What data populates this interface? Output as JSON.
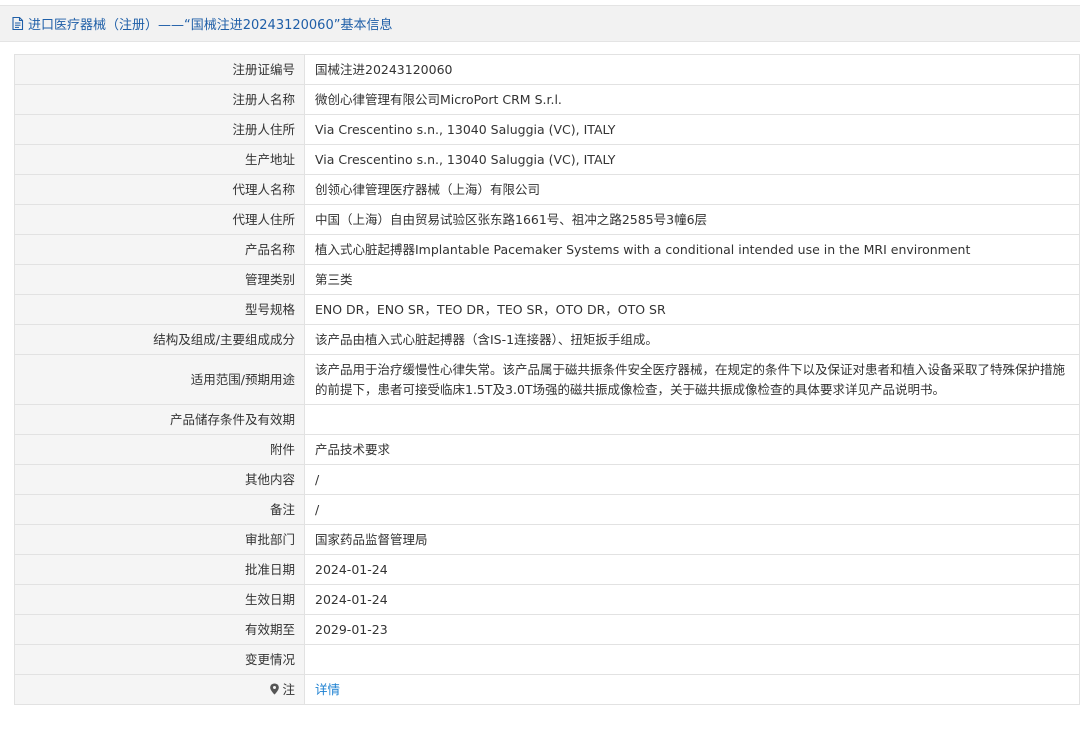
{
  "header": {
    "title": "进口医疗器械（注册）——“国械注进20243120060”基本信息"
  },
  "rows": [
    {
      "label": "注册证编号",
      "value": "国械注进20243120060"
    },
    {
      "label": "注册人名称",
      "value": "微创心律管理有限公司MicroPort CRM S.r.l."
    },
    {
      "label": "注册人住所",
      "value": "Via Crescentino s.n., 13040 Saluggia (VC), ITALY"
    },
    {
      "label": "生产地址",
      "value": "Via Crescentino s.n., 13040 Saluggia (VC), ITALY"
    },
    {
      "label": "代理人名称",
      "value": "创领心律管理医疗器械（上海）有限公司"
    },
    {
      "label": "代理人住所",
      "value": "中国（上海）自由贸易试验区张东路1661号、祖冲之路2585号3幢6层"
    },
    {
      "label": "产品名称",
      "value": "植入式心脏起搏器Implantable Pacemaker Systems with a conditional intended use in the MRI environment"
    },
    {
      "label": "管理类别",
      "value": "第三类"
    },
    {
      "label": "型号规格",
      "value": "ENO DR，ENO SR，TEO DR，TEO SR，OTO DR，OTO SR"
    },
    {
      "label": "结构及组成/主要组成成分",
      "value": "该产品由植入式心脏起搏器（含IS-1连接器）、扭矩扳手组成。"
    },
    {
      "label": "适用范围/预期用途",
      "value": "该产品用于治疗缓慢性心律失常。该产品属于磁共振条件安全医疗器械，在规定的条件下以及保证对患者和植入设备采取了特殊保护措施的前提下，患者可接受临床1.5T及3.0T场强的磁共振成像检查，关于磁共振成像检查的具体要求详见产品说明书。"
    },
    {
      "label": "产品储存条件及有效期",
      "value": ""
    },
    {
      "label": "附件",
      "value": "产品技术要求"
    },
    {
      "label": "其他内容",
      "value": "/"
    },
    {
      "label": "备注",
      "value": "/"
    },
    {
      "label": "审批部门",
      "value": "国家药品监督管理局"
    },
    {
      "label": "批准日期",
      "value": "2024-01-24"
    },
    {
      "label": "生效日期",
      "value": "2024-01-24"
    },
    {
      "label": "有效期至",
      "value": "2029-01-23"
    },
    {
      "label": "变更情况",
      "value": ""
    }
  ],
  "note": {
    "label": "注",
    "link": "详情",
    "icon": "map-pin-icon"
  },
  "colors": {
    "title_blue": "#1f5fa8",
    "link_blue": "#1a7fd1",
    "label_bg": "#f5f5f5",
    "header_bg": "#f2f2f2",
    "border": "#e2e2e2"
  }
}
